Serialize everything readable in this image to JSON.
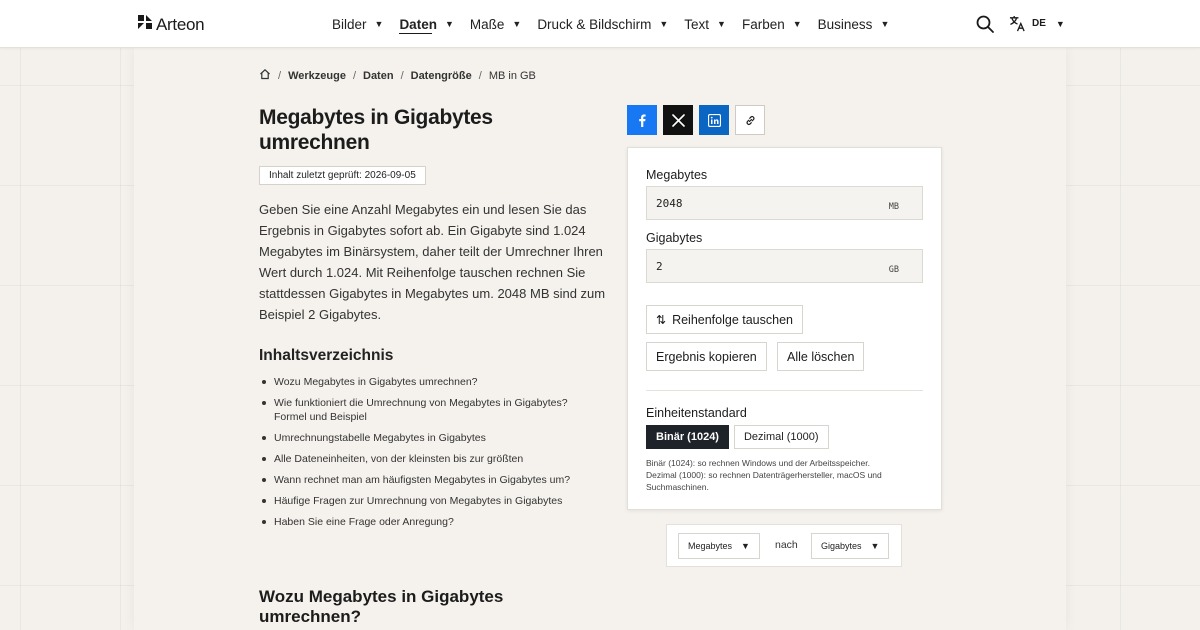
{
  "header": {
    "logo_text": "Arteon",
    "nav": [
      {
        "label": "Bilder",
        "active": false
      },
      {
        "label": "Daten",
        "active": true
      },
      {
        "label": "Maße",
        "active": false
      },
      {
        "label": "Druck & Bildschirm",
        "active": false
      },
      {
        "label": "Text",
        "active": false
      },
      {
        "label": "Farben",
        "active": false
      },
      {
        "label": "Business",
        "active": false
      }
    ],
    "caret_glyph": "▼",
    "lang_code": "DE",
    "icons": {
      "logo": "arteon-logo-icon",
      "search": "search-icon",
      "language": "translate-icon",
      "home": "home-icon"
    }
  },
  "breadcrumb": {
    "separator": "/",
    "items": [
      "Werkzeuge",
      "Daten",
      "Datengröße"
    ],
    "current": "MB in GB"
  },
  "page": {
    "title": "Megabytes in Gigabytes umrechnen",
    "review_badge": "Inhalt zuletzt geprüft: 2026-09-05",
    "intro": "Geben Sie eine Anzahl Megabytes ein und lesen Sie das Ergebnis in Gigabytes sofort ab. Ein Gigabyte sind 1.024 Megabytes im Binärsystem, daher teilt der Umrechner Ihren Wert durch 1.024. Mit Reihenfolge tauschen rechnen Sie stattdessen Gigabytes in Megabytes um. 2048 MB sind zum Beispiel 2 Gigabytes.",
    "toc_title": "Inhaltsverzeichnis",
    "toc": [
      "Wozu Megabytes in Gigabytes umrechnen?",
      "Wie funktioniert die Umrechnung von Megabytes in Gigabytes? Formel und Beispiel",
      "Umrechnungstabelle Megabytes in Gigabytes",
      "Alle Dateneinheiten, von der kleinsten bis zur größten",
      "Wann rechnet man am häufigsten Megabytes in Gigabytes um?",
      "Häufige Fragen zur Umrechnung von Megabytes in Gigabytes",
      "Haben Sie eine Frage oder Anregung?"
    ],
    "section_title": "Wozu Megabytes in Gigabytes umrechnen?"
  },
  "share": {
    "facebook": {
      "icon": "facebook-icon",
      "color": "#1877f2"
    },
    "x": {
      "icon": "x-icon",
      "color": "#111111"
    },
    "linkedin": {
      "icon": "linkedin-icon",
      "color": "#0a66c2"
    },
    "copy_link": {
      "icon": "link-icon"
    }
  },
  "converter": {
    "from_label": "Megabytes",
    "from_value": "2048",
    "from_unit": "MB",
    "to_label": "Gigabytes",
    "to_value": "2",
    "to_unit": "GB",
    "swap_label": "Reihenfolge tauschen",
    "swap_icon": "⇅",
    "copy_label": "Ergebnis kopieren",
    "clear_label": "Alle löschen",
    "standard_label": "Einheitenstandard",
    "standard_options": [
      {
        "label": "Binär (1024)",
        "selected": true
      },
      {
        "label": "Dezimal (1000)",
        "selected": false
      }
    ],
    "note_line1": "Binär (1024): so rechnen Windows und der Arbeitsspeicher.",
    "note_line2": "Dezimal (1000): so rechnen Datenträgerhersteller, macOS und Suchmaschinen."
  },
  "unit_selector": {
    "from": "Megabytes",
    "to_word": "nach",
    "to": "Gigabytes"
  },
  "colors": {
    "accent_dark": "#1e2229",
    "background": "#f4f1ec"
  }
}
